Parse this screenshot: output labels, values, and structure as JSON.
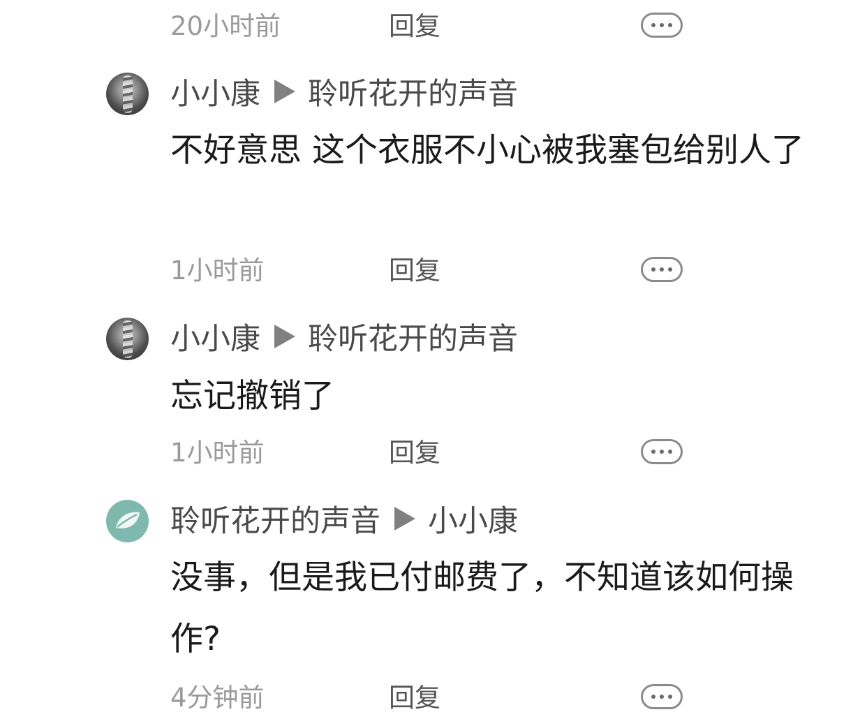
{
  "top_meta": {
    "time": "20小时前",
    "reply_label": "回复"
  },
  "comments": [
    {
      "from": "小小康",
      "to": "聆听花开的声音",
      "text": "不好意思 这个衣服不小心被我塞包给别人了",
      "time": "1小时前",
      "reply_label": "回复",
      "avatar": "photo-avatar"
    },
    {
      "from": "小小康",
      "to": "聆听花开的声音",
      "text": "忘记撤销了",
      "time": "1小时前",
      "reply_label": "回复",
      "avatar": "photo-avatar"
    },
    {
      "from": "聆听花开的声音",
      "to": "小小康",
      "text": "没事，但是我已付邮费了，不知道该如何操作?",
      "time": "4分钟前",
      "reply_label": "回复",
      "avatar": "leaf-avatar"
    }
  ],
  "icons": {
    "more": "more-dots-icon",
    "reply_arrow": "play-arrow-icon"
  },
  "colors": {
    "background": "#ffffff",
    "name_text": "#4a4a4a",
    "body_text": "#1a1a1a",
    "time_text": "#9a9a9a",
    "leaf_avatar": "#7fb9ae"
  }
}
